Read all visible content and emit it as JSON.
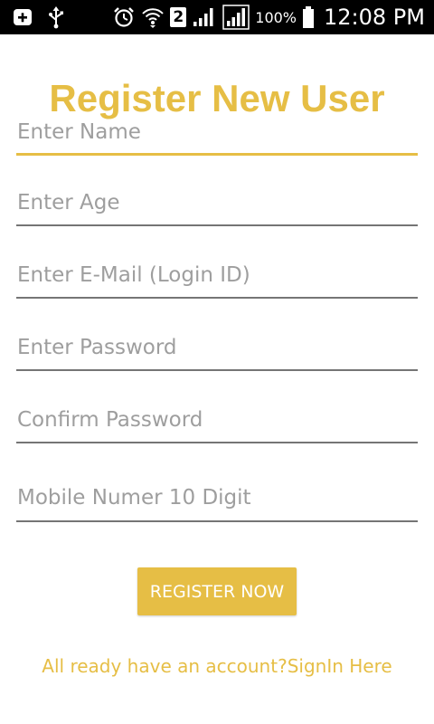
{
  "status_bar": {
    "icons": [
      "notification-plus-icon",
      "usb-icon",
      "alarm-icon",
      "wifi-icon",
      "signal-icon",
      "signal-icon",
      "battery-icon"
    ],
    "sim_slot": "2",
    "battery_percent": "100%",
    "time": "12:08 PM"
  },
  "form": {
    "title": "Register New User",
    "fields": {
      "name_placeholder": "Enter Name",
      "age_placeholder": "Enter Age",
      "email_placeholder": "Enter E-Mail (Login ID)",
      "password_placeholder": "Enter Password",
      "confirm_password_placeholder": "Confirm Password",
      "mobile_placeholder": "Mobile Numer 10 Digit"
    },
    "register_button_label": "REGISTER NOW",
    "signin_link_text": "All ready have an account?SignIn Here"
  },
  "colors": {
    "accent": "#e6be45",
    "status_bar": "#000000",
    "underline": "#757575",
    "placeholder": "#9e9e9e"
  }
}
